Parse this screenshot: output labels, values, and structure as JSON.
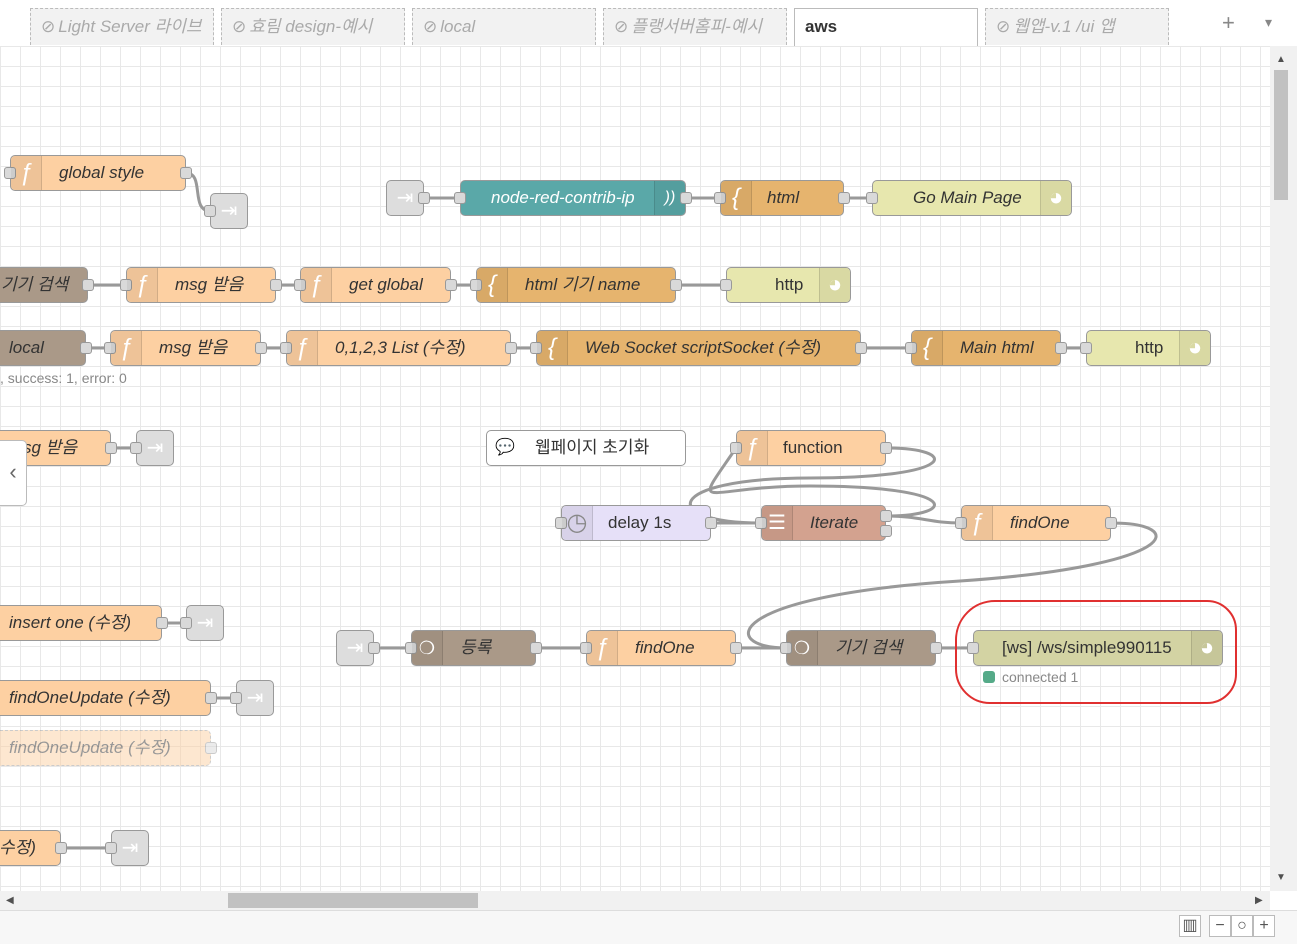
{
  "tabs": [
    {
      "label": "Light Server 라이브",
      "disabled": true
    },
    {
      "label": "효림 design-예시",
      "disabled": true
    },
    {
      "label": "local",
      "disabled": true
    },
    {
      "label": "플랭서버홈피-예시",
      "disabled": true
    },
    {
      "label": "aws",
      "disabled": false
    },
    {
      "label": "웹앱-v.1 /ui 앱",
      "disabled": true
    }
  ],
  "tab_icons": {
    "disabled": "⊘",
    "add": "+",
    "menu": "▾"
  },
  "nodes": {
    "global_style": "global style",
    "node_red_contrib_ip": "node-red-contrib-ip",
    "html1": "html",
    "go_main_page": "Go Main Page",
    "device_search1": "기기 검색",
    "msg_recv1": "msg 받음",
    "get_global": "get global",
    "html_device_name": "html 기기 name",
    "http1": "http",
    "local": "local",
    "msg_recv2": "msg 받음",
    "list_edit": "0,1,2,3 List (수정)",
    "ws_script_socket": "Web Socket scriptSocket (수정)",
    "main_html": "Main html",
    "http2": "http",
    "local_status": ", success: 1, error: 0",
    "msg_recv3": "sg 받음",
    "comment_init": "웹페이지 초기화",
    "function": "function",
    "delay": "delay 1s",
    "iterate": "Iterate",
    "findone1": "findOne",
    "insert_one": "insert one (수정)",
    "find_one_update1": "findOneUpdate (수정)",
    "find_one_update2": "findOneUpdate (수정)",
    "register": "등록",
    "findone2": "findOne",
    "device_search2": "기기 검색",
    "ws_out": "[ws] /ws/simple990115",
    "ws_status": "connected 1",
    "edit_tail": "수정)"
  },
  "icons": {
    "function": "ƒ",
    "template": "{",
    "link": "⇥",
    "globe": "◕",
    "ip": "))",
    "mongo": "❍",
    "iterate": "☰",
    "delay": "◷",
    "comment": "💬",
    "collapse_sidebar": "‹",
    "map": "▥",
    "zoom_out": "−",
    "zoom_reset": "○",
    "zoom_in": "+",
    "scroll_up": "▲",
    "scroll_down": "▼",
    "scroll_left": "◀",
    "scroll_right": "▶"
  },
  "colors": {
    "highlight": "#e03030",
    "status_connected": "#55aa88"
  }
}
